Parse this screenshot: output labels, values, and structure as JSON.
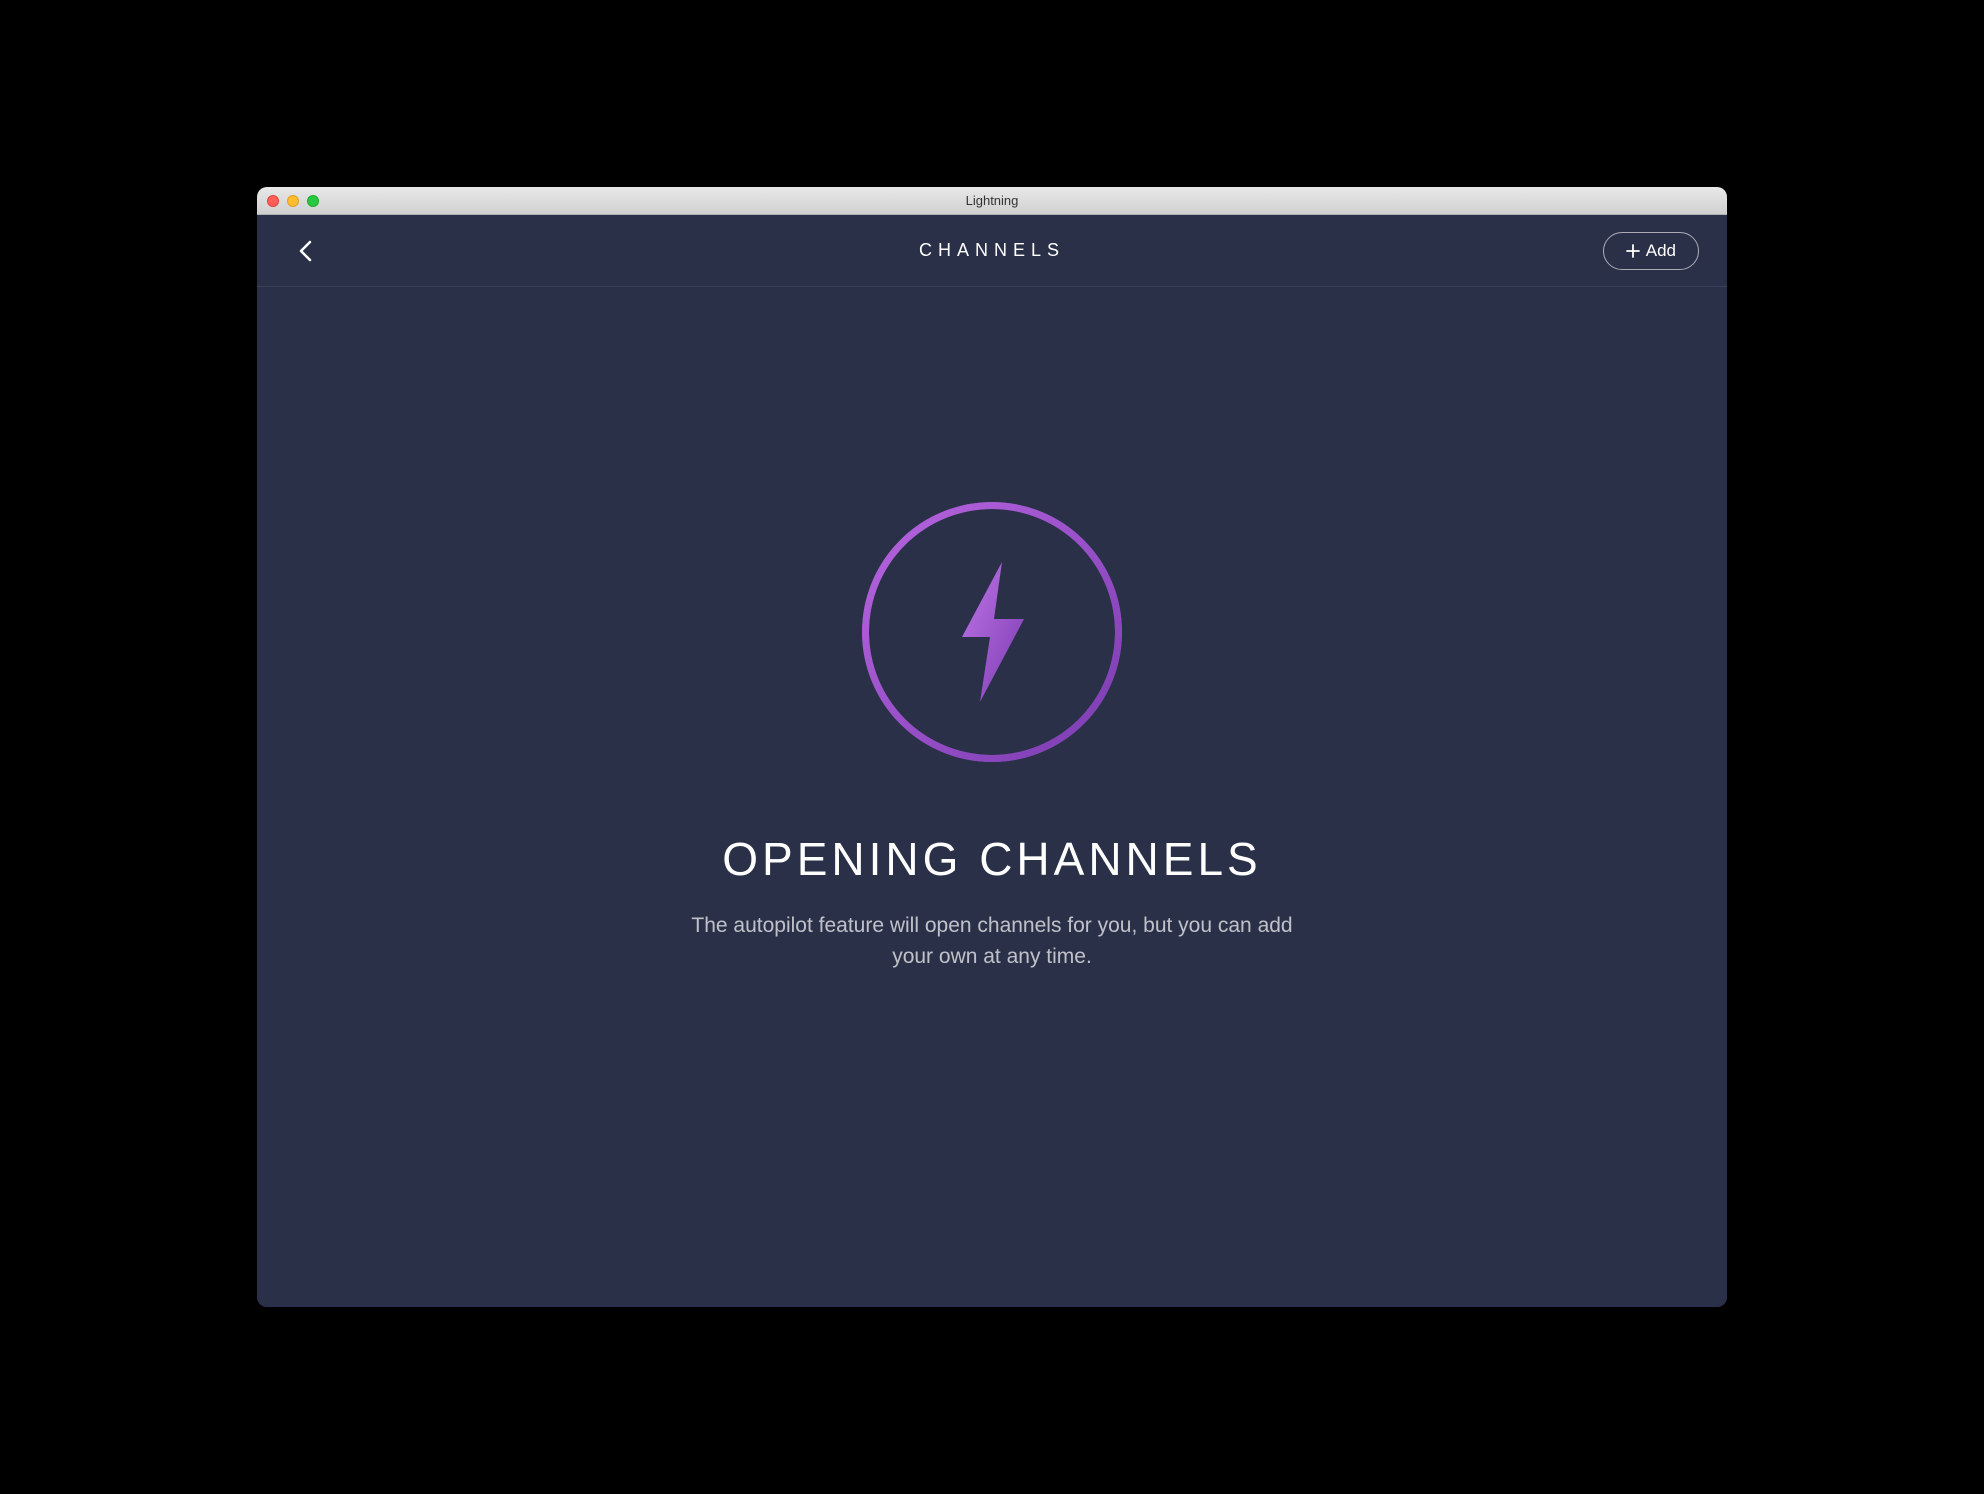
{
  "window": {
    "title": "Lightning"
  },
  "header": {
    "title": "CHANNELS",
    "add_button_label": "Add"
  },
  "main": {
    "title": "OPENING CHANNELS",
    "subtitle": "The autopilot feature will open channels for you, but you can add your own at any time."
  },
  "colors": {
    "background": "#2a3048",
    "accent_purple_light": "#b866e0",
    "accent_purple_dark": "#7a3bb0"
  }
}
